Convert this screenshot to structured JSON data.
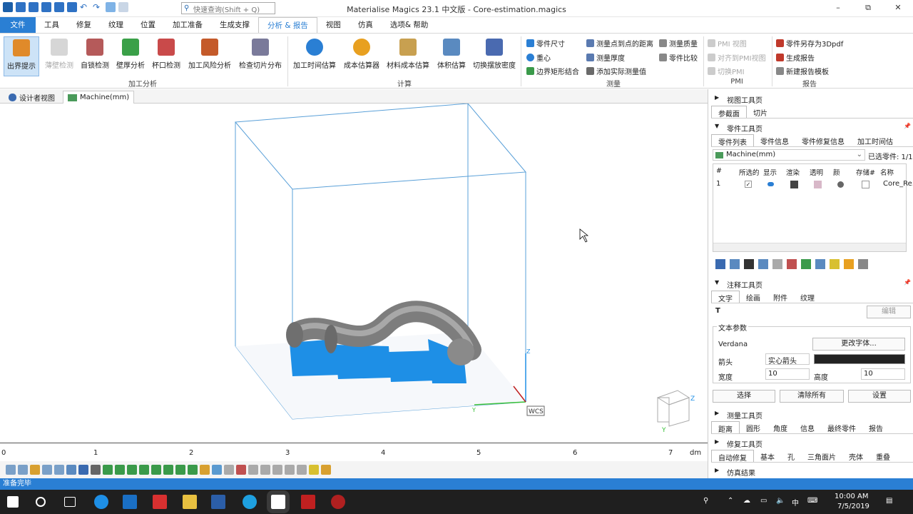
{
  "app": {
    "title": "Materialise Magics 23.1 中文版 - Core-estimation.magics",
    "search_placeholder": "快速查询(Shift + Q)"
  },
  "window": {
    "minimize": "–",
    "maximize": "⧉",
    "close": "✕"
  },
  "menu": [
    "文件",
    "工具",
    "修复",
    "纹理",
    "位置",
    "加工准备",
    "生成支撑",
    "分析 & 报告",
    "视图",
    "仿真",
    "选项& 帮助"
  ],
  "ribbon": {
    "analysis": {
      "group": "加工分析",
      "buttons": [
        "出界提示",
        "薄壁检测",
        "自锁检测",
        "壁厚分析",
        "杯口检测",
        "加工风险分析",
        "检查切片分布"
      ]
    },
    "calc": {
      "group": "计算",
      "buttons": [
        "加工时间估算",
        "成本估算器",
        "材料成本估算",
        "体积估算",
        "切换摆放密度"
      ]
    },
    "measure": {
      "group": "测量",
      "items": [
        "零件尺寸",
        "重心",
        "边界矩形结合",
        "测量点到点的距离",
        "测量厚度",
        "添加实际测量值",
        "测量质量",
        "零件比较"
      ]
    },
    "pmi": {
      "group": "PMI",
      "items": [
        "PMI 视图",
        "对齐到PMI视图",
        "切换PMI"
      ]
    },
    "report": {
      "group": "报告",
      "items": [
        "零件另存为3Dpdf",
        "生成报告",
        "新建报告模板"
      ]
    }
  },
  "view_tabs": [
    "设计者视图",
    "Machine(mm)"
  ],
  "viewport": {
    "wcs": "WCS",
    "axis_z": "Z",
    "axis_y": "Y",
    "cube_z": "Z",
    "cube_y": "Y"
  },
  "ruler": {
    "ticks": [
      "0",
      "1",
      "2",
      "3",
      "4",
      "5",
      "6",
      "7"
    ],
    "unit": "dm"
  },
  "status": "准备完毕",
  "panel": {
    "view_toolbar": {
      "title": "视图工具页",
      "tabs": [
        "参截面",
        "切片"
      ]
    },
    "part_toolbar": {
      "title": "零件工具页",
      "tabs": [
        "零件列表",
        "零件信息",
        "零件修复信息",
        "加工时间估"
      ],
      "machine": "Machine(mm)",
      "selected": "已选零件: 1/1",
      "columns": [
        "#",
        "所选的",
        "显示",
        "渲染",
        "透明",
        "颜",
        "存储#",
        "名称"
      ],
      "rows": [
        {
          "num": "1",
          "name": "Core_Re..."
        }
      ]
    },
    "annotation_toolbar": {
      "title": "注释工具页",
      "tabs": [
        "文字",
        "绘画",
        "附件",
        "纹理"
      ],
      "edit": "编辑",
      "text_params": "文本参数",
      "font": "Verdana",
      "change_font": "更改字体...",
      "arrow_label": "箭头",
      "arrow_value": "实心箭头",
      "width_label": "宽度",
      "width_value": "10",
      "height_label": "高度",
      "height_value": "10",
      "select": "选择",
      "clear_all": "清除所有",
      "settings": "设置"
    },
    "measure_toolbar": {
      "title": "测量工具页",
      "tabs": [
        "距离",
        "圆形",
        "角度",
        "信息",
        "最终零件",
        "报告"
      ]
    },
    "repair_toolbar": {
      "title": "修复工具页",
      "tabs": [
        "自动修复",
        "基本",
        "孔",
        "三角面片",
        "壳体",
        "重叠"
      ]
    },
    "sim_results": {
      "title": "仿真结果"
    }
  },
  "tray": {
    "time": "10:00 AM",
    "date": "7/5/2019",
    "ime": "中"
  },
  "colors": {
    "accent": "#2a7fd4",
    "support": "#1e8fe6",
    "part": "#8a8a8a",
    "box": "#5aa0d8"
  }
}
